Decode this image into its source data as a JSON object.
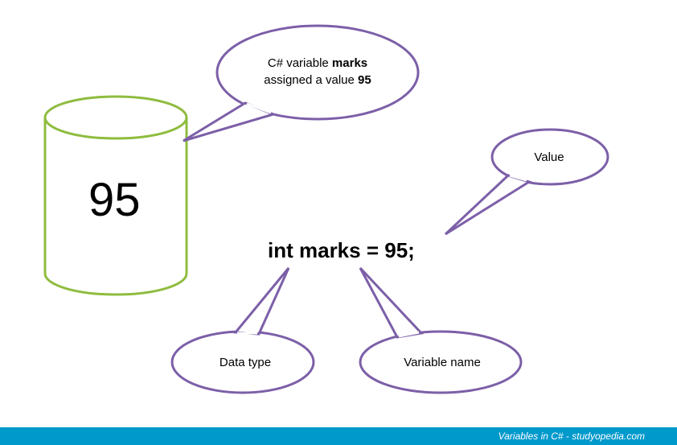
{
  "cylinder": {
    "value": "95"
  },
  "code": {
    "statement": "int marks = 95;"
  },
  "callouts": {
    "top": {
      "line1_prefix": "C# variable ",
      "line1_bold": "marks",
      "line2_prefix": "assigned a value ",
      "line2_bold": "95"
    },
    "value": "Value",
    "datatype": "Data type",
    "varname": "Variable name"
  },
  "footer": {
    "text": "Variables in C# - studyopedia.com"
  },
  "colors": {
    "purple": "#7c5fa8",
    "green": "#8fbc3f",
    "footer": "#0099cc"
  }
}
